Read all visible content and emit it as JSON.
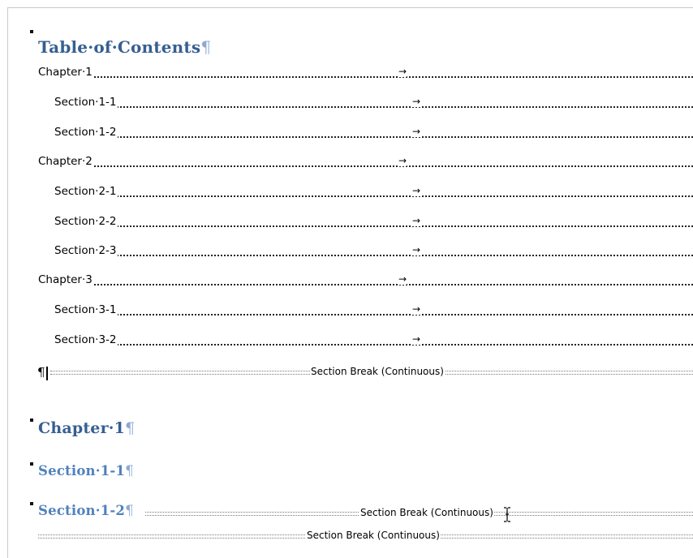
{
  "document": {
    "toc_title": "Table·of·Contents",
    "pilcrow": "¶",
    "tab_arrow": "→",
    "toc_entries": [
      {
        "label": "Chapter·1",
        "level": 1
      },
      {
        "label": "Section·1-1",
        "level": 2
      },
      {
        "label": "Section·1-2",
        "level": 2
      },
      {
        "label": "Chapter·2",
        "level": 1
      },
      {
        "label": "Section·2-1",
        "level": 2
      },
      {
        "label": "Section·2-2",
        "level": 2
      },
      {
        "label": "Section·2-3",
        "level": 2
      },
      {
        "label": "Chapter·3",
        "level": 1
      },
      {
        "label": "Section·3-1",
        "level": 2
      },
      {
        "label": "Section·3-2",
        "level": 2
      }
    ],
    "section_break_label": "Section Break (Continuous)",
    "body_headings": [
      {
        "text": "Chapter·1",
        "level": 1
      },
      {
        "text": "Section·1-1",
        "level": 2
      },
      {
        "text": "Section·1-2",
        "level": 2
      }
    ]
  }
}
